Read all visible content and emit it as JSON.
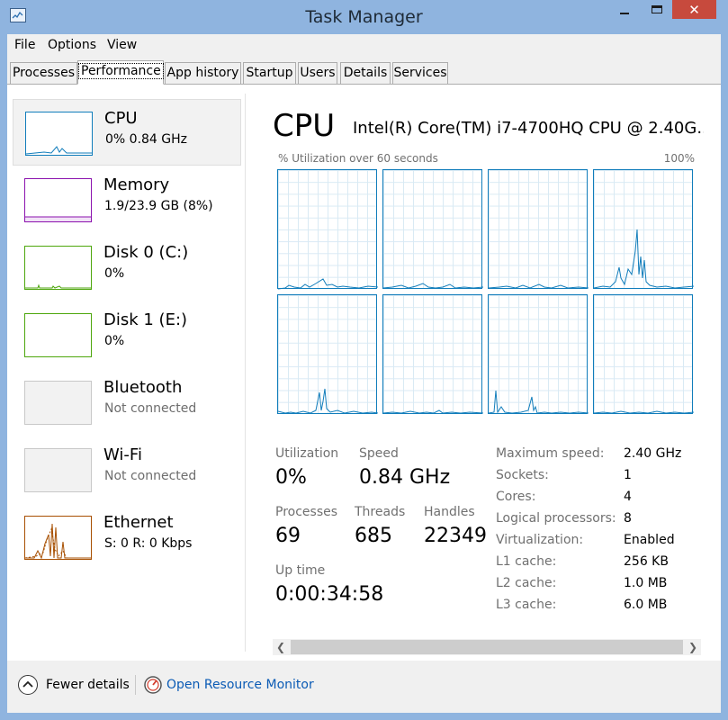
{
  "window": {
    "title": "Task Manager",
    "close_glyph": "✕"
  },
  "menu": [
    {
      "label": "File"
    },
    {
      "label": "Options"
    },
    {
      "label": "View"
    }
  ],
  "tabs": [
    {
      "label": "Processes"
    },
    {
      "label": "Performance",
      "active": true
    },
    {
      "label": "App history"
    },
    {
      "label": "Startup"
    },
    {
      "label": "Users"
    },
    {
      "label": "Details"
    },
    {
      "label": "Services"
    }
  ],
  "sidebar": {
    "items": [
      {
        "title": "CPU",
        "sub": "0%  0.84 GHz",
        "color": "#117dbb",
        "selected": true
      },
      {
        "title": "Memory",
        "sub": "1.9/23.9 GB (8%)",
        "color": "#8b12ae"
      },
      {
        "title": "Disk 0 (C:)",
        "sub": "0%",
        "color": "#4da60c"
      },
      {
        "title": "Disk 1 (E:)",
        "sub": "0%",
        "color": "#4da60c"
      },
      {
        "title": "Bluetooth",
        "sub": "Not connected",
        "color": "#c0c0c0"
      },
      {
        "title": "Wi-Fi",
        "sub": "Not connected",
        "color": "#c0c0c0"
      },
      {
        "title": "Ethernet",
        "sub": "S: 0  R: 0 Kbps",
        "color": "#a74f01"
      }
    ]
  },
  "main": {
    "title": "CPU",
    "cpu_name": "Intel(R) Core(TM) i7-4700HQ CPU @ 2.40G...",
    "graph_label": "% Utilization over 60 seconds",
    "graph_max": "100%",
    "stats": {
      "utilization_label": "Utilization",
      "utilization": "0%",
      "speed_label": "Speed",
      "speed": "0.84 GHz",
      "processes_label": "Processes",
      "processes": "69",
      "threads_label": "Threads",
      "threads": "685",
      "handles_label": "Handles",
      "handles": "22349",
      "uptime_label": "Up time",
      "uptime": "0:00:34:58"
    },
    "specs": [
      {
        "label": "Maximum speed:",
        "value": "2.40 GHz"
      },
      {
        "label": "Sockets:",
        "value": "1"
      },
      {
        "label": "Cores:",
        "value": "4"
      },
      {
        "label": "Logical processors:",
        "value": "8"
      },
      {
        "label": "Virtualization:",
        "value": "Enabled"
      },
      {
        "label": "L1 cache:",
        "value": "256 KB"
      },
      {
        "label": "L2 cache:",
        "value": "1.0 MB"
      },
      {
        "label": "L3 cache:",
        "value": "6.0 MB"
      }
    ]
  },
  "footer": {
    "fewer_details": "Fewer details",
    "resource_monitor": "Open Resource Monitor"
  },
  "icons": {
    "app": "task-manager-icon",
    "fewer": "chevron-up-circle-icon",
    "resmon": "resource-monitor-icon"
  },
  "colors": {
    "accent": "#117dbb",
    "titlebar": "#8fb4df",
    "close": "#c74a3d",
    "link": "#0b5bb5"
  }
}
